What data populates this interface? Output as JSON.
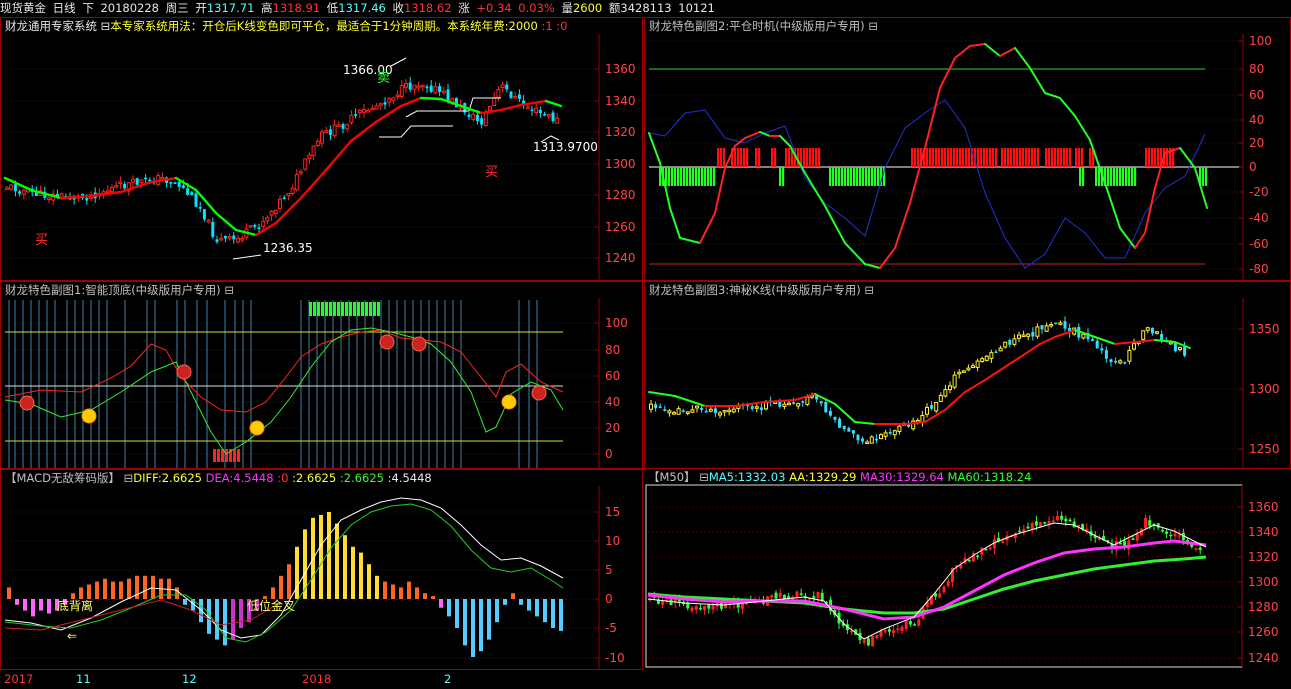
{
  "topbar": {
    "instrument": "现货黄金",
    "period": "日线",
    "arrow": "下",
    "date": "20180228",
    "weekday": "周三",
    "open_label": "开",
    "open": "1317.71",
    "high_label": "高",
    "high": "1318.91",
    "low_label": "低",
    "low": "1317.46",
    "close_label": "收",
    "close": "1318.62",
    "change_label": "涨",
    "change": "+0.34",
    "change_pct": "0.03%",
    "volume_label": "量",
    "volume": "2600",
    "amount_label": "额",
    "amount": "3428113",
    "extra": "10121"
  },
  "panels": {
    "main": {
      "title_a": "财龙通用专家系统",
      "title_b": "本专家系统用法：开仓后K线变色即可平仓，最适合于1分钟周期。本系统年费:2000",
      "title_c": ":1 :0",
      "yticks": [
        "1360",
        "1340",
        "1320",
        "1300",
        "1280",
        "1260",
        "1240"
      ],
      "ann_high": "1366.00",
      "ann_low": "1236.35",
      "ann_last": "1313.9700",
      "buy_label": "买",
      "sell_label": "卖",
      "buy_label_2": "买",
      "colors": {
        "up": "#ff2222",
        "down": "#00e5ff",
        "ma_up": "#ff0000",
        "ma_down": "#00ff00"
      }
    },
    "sub2": {
      "title": "财龙特色副图2:平仓时机(中级版用户专用)",
      "yticks": [
        "100",
        "80",
        "60",
        "40",
        "20",
        "0",
        "-20",
        "-40",
        "-60",
        "-80"
      ]
    },
    "sub1": {
      "title": "财龙特色副图1:智能顶底(中级版用户专用)",
      "yticks": [
        "100",
        "80",
        "60",
        "40",
        "20",
        "0"
      ]
    },
    "sub3": {
      "title": "财龙特色副图3:神秘K线(中级版用户专用)",
      "yticks": [
        "1350",
        "1300",
        "1250"
      ]
    },
    "macd": {
      "title": "【MACD无敌筹码版】",
      "diff_label": "DIFF:2.6625",
      "dea_label": "DEA:4.5448",
      "v1": ":0",
      "v2": ":2.6625",
      "v3": ":2.6625",
      "v4": ":4.5448",
      "ann_divergence": "底背离",
      "ann_cross": "低位金叉",
      "yticks": [
        "15",
        "10",
        "5",
        "0",
        "-5",
        "-10"
      ]
    },
    "m50": {
      "title": "【M50】",
      "ma5": "MA5:1332.03",
      "aa": "AA:1329.29",
      "ma30": "MA30:1329.64",
      "ma60": "MA60:1318.24",
      "yticks": [
        "1360",
        "1340",
        "1320",
        "1300",
        "1280",
        "1260",
        "1240"
      ]
    }
  },
  "xaxis": {
    "labels": [
      "2017",
      "11",
      "12",
      "2018",
      "2"
    ]
  }
}
